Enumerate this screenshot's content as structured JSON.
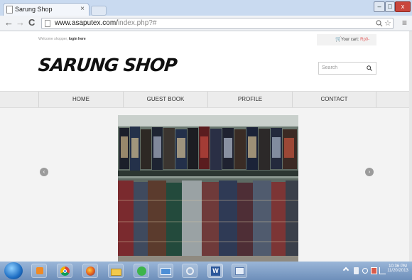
{
  "browser": {
    "tab_title": "Sarung Shop",
    "tab_close": "×",
    "url_host": "www.asaputex.com/",
    "url_path": "index.php?#",
    "back": "←",
    "forward": "→",
    "reload": "C",
    "search_icon": "search-icon",
    "star_icon": "☆",
    "menu_icon": "≡",
    "window_buttons": {
      "minimize": "–",
      "maximize": "□",
      "close": "x"
    }
  },
  "header": {
    "welcome_prefix": "Welcome shopper,",
    "login_link": "login here",
    "cart_label": "Your cart:",
    "cart_amount": "Rp0-",
    "logo": "SARUNG SHOP",
    "search_placeholder": "Search"
  },
  "nav": {
    "items": [
      {
        "label": "HOME"
      },
      {
        "label": "GUEST BOOK"
      },
      {
        "label": "PROFILE"
      },
      {
        "label": "CONTACT"
      }
    ]
  },
  "slider": {
    "prev_icon": "‹",
    "next_icon": "›",
    "image_description": "shelves-of-sarung"
  },
  "taskbar": {
    "time": "10:36 PM",
    "date": "11/20/2013",
    "apps": [
      "explorer",
      "media-player",
      "chrome",
      "firefox",
      "file-manager",
      "messenger",
      "network-tool",
      "disk-tool",
      "word",
      "window"
    ]
  }
}
